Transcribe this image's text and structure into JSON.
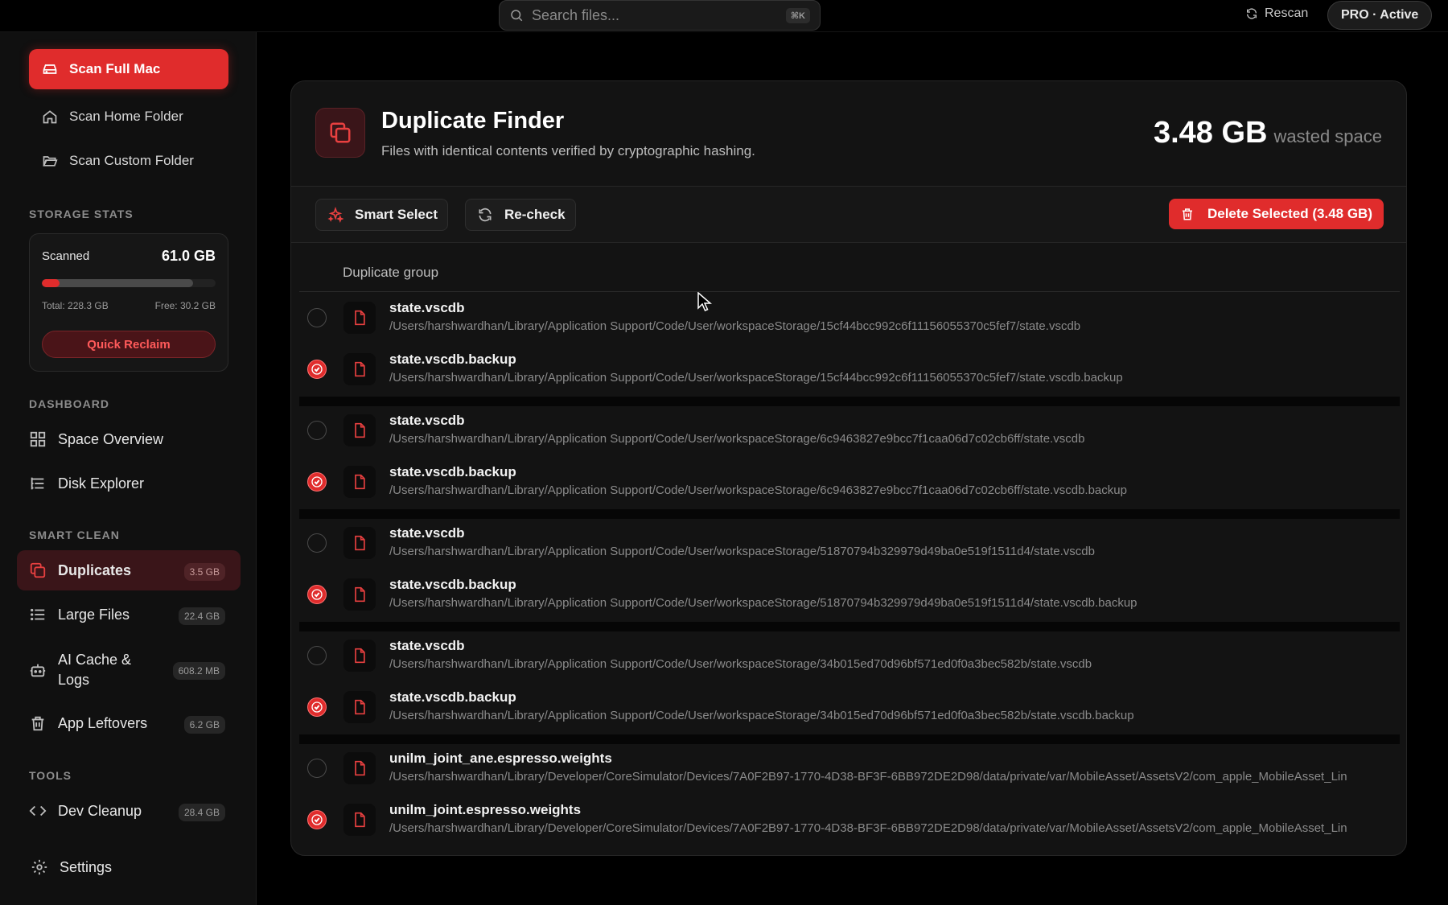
{
  "topbar": {
    "search_placeholder": "Search files...",
    "search_shortcut": "⌘K",
    "rescan_label": "Rescan",
    "pro_label": "PRO · Active"
  },
  "sidebar": {
    "scan_full": "Scan Full Mac",
    "scan_home": "Scan Home Folder",
    "scan_custom": "Scan Custom Folder",
    "storage_heading": "STORAGE STATS",
    "storage": {
      "scanned_label": "Scanned",
      "scanned_value": "61.0 GB",
      "total": "Total: 228.3 GB",
      "free": "Free: 30.2 GB",
      "used_fraction": 0.87,
      "scanned_fraction": 0.1,
      "quick_reclaim": "Quick Reclaim"
    },
    "dashboard_heading": "DASHBOARD",
    "dashboard": [
      {
        "label": "Space Overview",
        "icon": "grid-icon"
      },
      {
        "label": "Disk Explorer",
        "icon": "tree-list-icon"
      }
    ],
    "smart_clean_heading": "SMART CLEAN",
    "smart_clean": [
      {
        "label": "Duplicates",
        "badge": "3.5 GB",
        "icon": "copy-icon",
        "active": true
      },
      {
        "label": "Large Files",
        "badge": "22.4 GB",
        "icon": "list-icon"
      },
      {
        "label": "AI Cache &",
        "label2": "Logs",
        "badge": "608.2 MB",
        "icon": "robot-icon"
      },
      {
        "label": "App Leftovers",
        "badge": "6.2 GB",
        "icon": "trash-icon"
      }
    ],
    "tools_heading": "TOOLS",
    "tools": [
      {
        "label": "Dev Cleanup",
        "badge": "28.4 GB",
        "icon": "code-icon"
      }
    ],
    "settings": "Settings"
  },
  "panel": {
    "title": "Duplicate Finder",
    "subtitle": "Files with identical contents verified by cryptographic hashing.",
    "wasted_value": "3.48 GB",
    "wasted_label": "wasted space",
    "smart_select": "Smart Select",
    "recheck": "Re-check",
    "delete_selected": "Delete Selected (3.48 GB)",
    "column_header": "Duplicate group",
    "groups": [
      {
        "files": [
          {
            "name": "state.vscdb",
            "path": "/Users/harshwardhan/Library/Application Support/Code/User/workspaceStorage/15cf44bcc992c6f11156055370c5fef7/state.vscdb",
            "selected": false
          },
          {
            "name": "state.vscdb.backup",
            "path": "/Users/harshwardhan/Library/Application Support/Code/User/workspaceStorage/15cf44bcc992c6f11156055370c5fef7/state.vscdb.backup",
            "selected": true
          }
        ]
      },
      {
        "files": [
          {
            "name": "state.vscdb",
            "path": "/Users/harshwardhan/Library/Application Support/Code/User/workspaceStorage/6c9463827e9bcc7f1caa06d7c02cb6ff/state.vscdb",
            "selected": false
          },
          {
            "name": "state.vscdb.backup",
            "path": "/Users/harshwardhan/Library/Application Support/Code/User/workspaceStorage/6c9463827e9bcc7f1caa06d7c02cb6ff/state.vscdb.backup",
            "selected": true
          }
        ]
      },
      {
        "files": [
          {
            "name": "state.vscdb",
            "path": "/Users/harshwardhan/Library/Application Support/Code/User/workspaceStorage/51870794b329979d49ba0e519f1511d4/state.vscdb",
            "selected": false
          },
          {
            "name": "state.vscdb.backup",
            "path": "/Users/harshwardhan/Library/Application Support/Code/User/workspaceStorage/51870794b329979d49ba0e519f1511d4/state.vscdb.backup",
            "selected": true
          }
        ]
      },
      {
        "files": [
          {
            "name": "state.vscdb",
            "path": "/Users/harshwardhan/Library/Application Support/Code/User/workspaceStorage/34b015ed70d96bf571ed0f0a3bec582b/state.vscdb",
            "selected": false
          },
          {
            "name": "state.vscdb.backup",
            "path": "/Users/harshwardhan/Library/Application Support/Code/User/workspaceStorage/34b015ed70d96bf571ed0f0a3bec582b/state.vscdb.backup",
            "selected": true
          }
        ]
      },
      {
        "files": [
          {
            "name": "unilm_joint_ane.espresso.weights",
            "path": "/Users/harshwardhan/Library/Developer/CoreSimulator/Devices/7A0F2B97-1770-4D38-BF3F-6BB972DE2D98/data/private/var/MobileAsset/AssetsV2/com_apple_MobileAsset_Lin",
            "selected": false
          },
          {
            "name": "unilm_joint.espresso.weights",
            "path": "/Users/harshwardhan/Library/Developer/CoreSimulator/Devices/7A0F2B97-1770-4D38-BF3F-6BB972DE2D98/data/private/var/MobileAsset/AssetsV2/com_apple_MobileAsset_Lin",
            "selected": true
          }
        ]
      }
    ]
  },
  "colors": {
    "accent": "#e02c2c",
    "background": "#000000",
    "sidebar": "#101010",
    "panel": "#131313"
  }
}
